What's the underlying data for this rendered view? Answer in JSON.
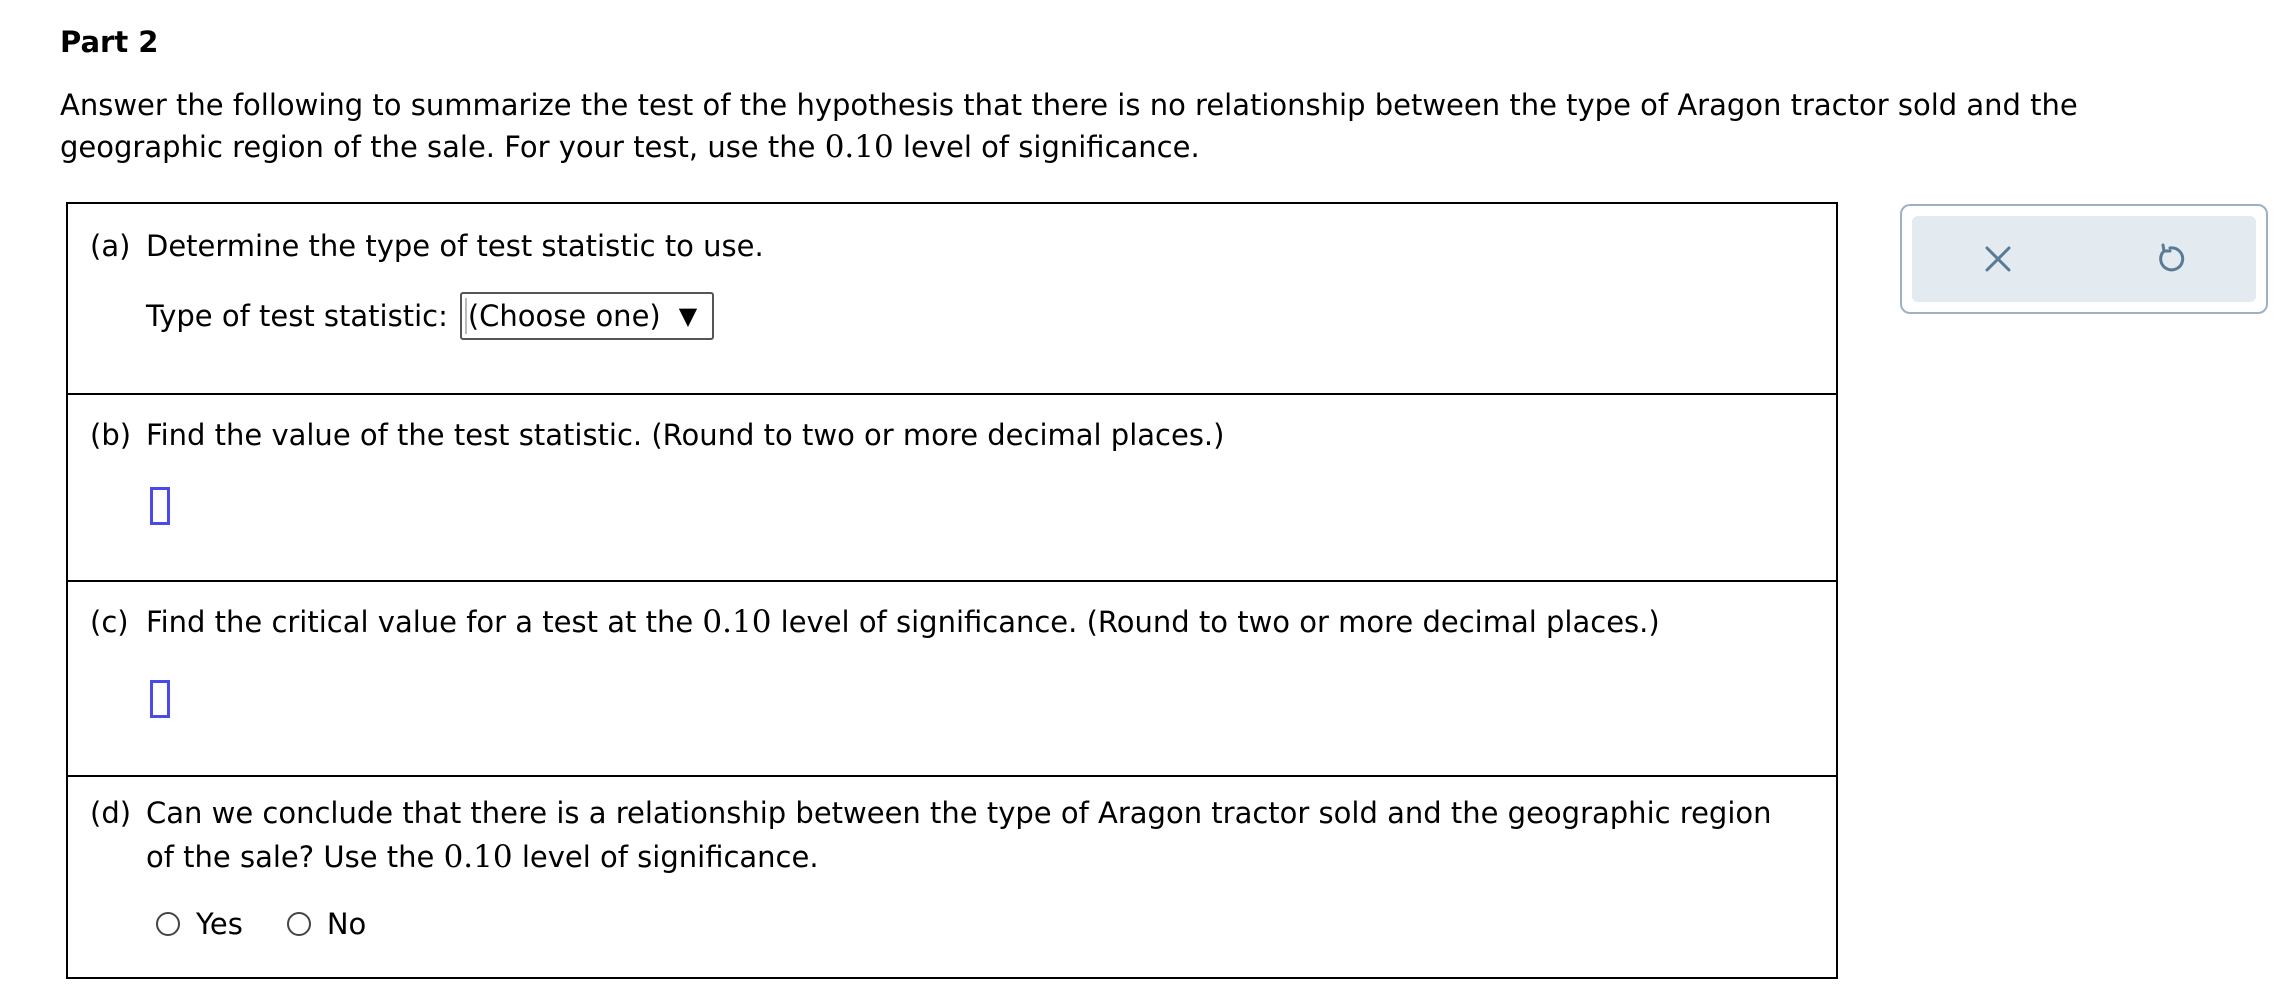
{
  "part_title": "Part 2",
  "intro": {
    "text_before": "Answer the following to summarize the test of the hypothesis that there is no relationship between the type of Aragon tractor sold and the geographic region of the sale. For your test, use the ",
    "alpha": "0.10",
    "text_after": " level of significance."
  },
  "questions": {
    "a": {
      "label": "(a)",
      "text": "Determine the type of test statistic to use.",
      "select_label": "Type of test statistic:",
      "select_value": "(Choose one)",
      "select_arrow": "▼"
    },
    "b": {
      "label": "(b)",
      "text": "Find the value of the test statistic. (Round to two or more decimal places.)",
      "answer_value": ""
    },
    "c": {
      "label": "(c)",
      "text_before": "Find the critical value for a test at the ",
      "alpha": "0.10",
      "text_after": " level of significance. (Round to two or more decimal places.)",
      "answer_value": ""
    },
    "d": {
      "label": "(d)",
      "text_before": "Can we conclude that there is a relationship between the type of Aragon tractor sold and the geographic region of the sale? Use the ",
      "alpha": "0.10",
      "text_after": " level of significance.",
      "options": [
        "Yes",
        "No"
      ]
    }
  },
  "toolbar": {
    "clear_icon": "close-icon",
    "reset_icon": "undo-icon",
    "icon_color": "#5a7b95"
  }
}
